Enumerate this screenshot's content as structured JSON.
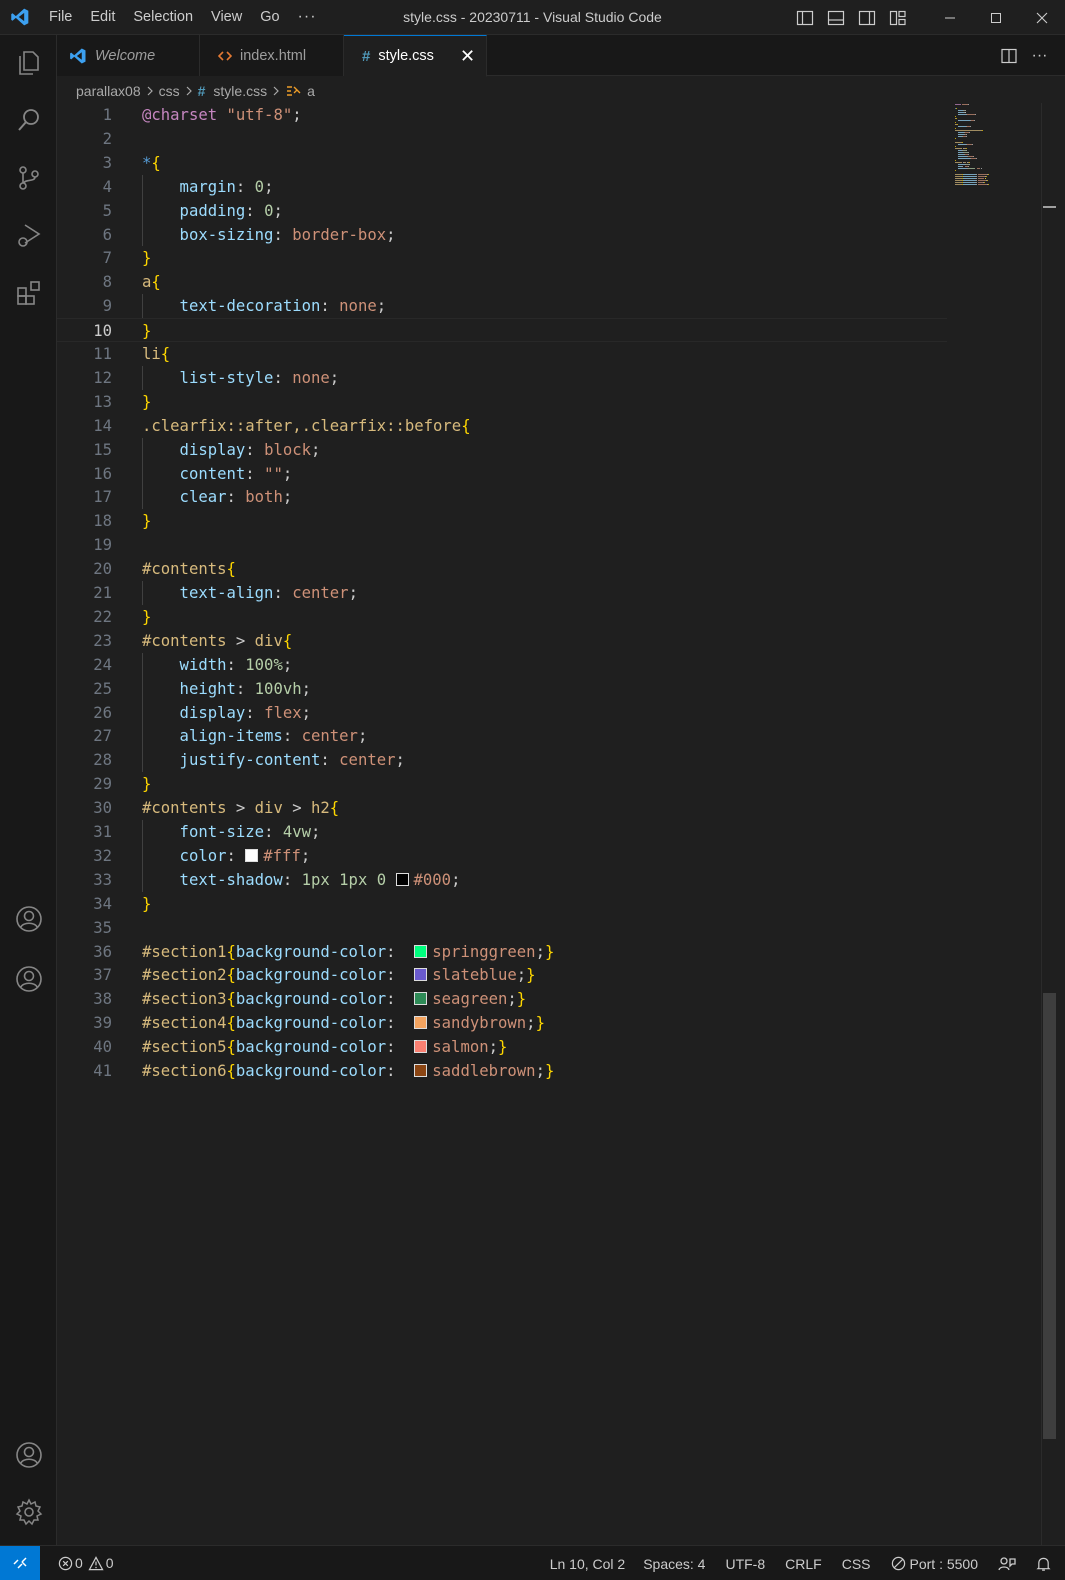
{
  "window": {
    "title": "style.css - 20230711 - Visual Studio Code",
    "menu": [
      "File",
      "Edit",
      "Selection",
      "View",
      "Go"
    ],
    "menu_more": "···"
  },
  "tabs": [
    {
      "label": "Welcome",
      "icon": "vscode-logo-icon",
      "italic": true
    },
    {
      "label": "index.html",
      "icon": "html-file-icon"
    },
    {
      "label": "style.css",
      "icon": "css-file-icon",
      "active": true,
      "close": "✕"
    }
  ],
  "breadcrumb": {
    "folder1": "parallax08",
    "folder2": "css",
    "file_glyph": "#",
    "file": "style.css",
    "symbol": "a"
  },
  "editor": {
    "current_line": 10,
    "lines": [
      {
        "n": "1",
        "tokens": [
          {
            "t": "@charset",
            "c": "at"
          },
          {
            "t": " ",
            "c": "punc"
          },
          {
            "t": "\"utf-8\"",
            "c": "str"
          },
          {
            "t": ";",
            "c": "punc"
          }
        ]
      },
      {
        "n": "2",
        "tokens": []
      },
      {
        "n": "3",
        "tokens": [
          {
            "t": "*",
            "c": "star"
          },
          {
            "t": "{",
            "c": "brace"
          }
        ]
      },
      {
        "n": "4",
        "tokens": [
          {
            "t": "    margin",
            "c": "prop"
          },
          {
            "t": ": ",
            "c": "punc"
          },
          {
            "t": "0",
            "c": "num"
          },
          {
            "t": ";",
            "c": "punc"
          }
        ]
      },
      {
        "n": "5",
        "tokens": [
          {
            "t": "    padding",
            "c": "prop"
          },
          {
            "t": ": ",
            "c": "punc"
          },
          {
            "t": "0",
            "c": "num"
          },
          {
            "t": ";",
            "c": "punc"
          }
        ]
      },
      {
        "n": "6",
        "tokens": [
          {
            "t": "    box-sizing",
            "c": "prop"
          },
          {
            "t": ": ",
            "c": "punc"
          },
          {
            "t": "border-box",
            "c": "val"
          },
          {
            "t": ";",
            "c": "punc"
          }
        ]
      },
      {
        "n": "7",
        "tokens": [
          {
            "t": "}",
            "c": "brace"
          }
        ]
      },
      {
        "n": "8",
        "tokens": [
          {
            "t": "a",
            "c": "tag"
          },
          {
            "t": "{",
            "c": "brace"
          }
        ]
      },
      {
        "n": "9",
        "tokens": [
          {
            "t": "    text-decoration",
            "c": "prop"
          },
          {
            "t": ": ",
            "c": "punc"
          },
          {
            "t": "none",
            "c": "val"
          },
          {
            "t": ";",
            "c": "punc"
          }
        ]
      },
      {
        "n": "10",
        "tokens": [
          {
            "t": "}",
            "c": "brace"
          }
        ]
      },
      {
        "n": "11",
        "tokens": [
          {
            "t": "li",
            "c": "tag"
          },
          {
            "t": "{",
            "c": "brace"
          }
        ]
      },
      {
        "n": "12",
        "tokens": [
          {
            "t": "    list-style",
            "c": "prop"
          },
          {
            "t": ": ",
            "c": "punc"
          },
          {
            "t": "none",
            "c": "val"
          },
          {
            "t": ";",
            "c": "punc"
          }
        ]
      },
      {
        "n": "13",
        "tokens": [
          {
            "t": "}",
            "c": "brace"
          }
        ]
      },
      {
        "n": "14",
        "tokens": [
          {
            "t": ".clearfix::after,.clearfix::before",
            "c": "sel"
          },
          {
            "t": "{",
            "c": "brace"
          }
        ]
      },
      {
        "n": "15",
        "tokens": [
          {
            "t": "    display",
            "c": "prop"
          },
          {
            "t": ": ",
            "c": "punc"
          },
          {
            "t": "block",
            "c": "val"
          },
          {
            "t": ";",
            "c": "punc"
          }
        ]
      },
      {
        "n": "16",
        "tokens": [
          {
            "t": "    content",
            "c": "prop"
          },
          {
            "t": ": ",
            "c": "punc"
          },
          {
            "t": "\"\"",
            "c": "str"
          },
          {
            "t": ";",
            "c": "punc"
          }
        ]
      },
      {
        "n": "17",
        "tokens": [
          {
            "t": "    clear",
            "c": "prop"
          },
          {
            "t": ": ",
            "c": "punc"
          },
          {
            "t": "both",
            "c": "val"
          },
          {
            "t": ";",
            "c": "punc"
          }
        ]
      },
      {
        "n": "18",
        "tokens": [
          {
            "t": "}",
            "c": "brace"
          }
        ]
      },
      {
        "n": "19",
        "tokens": []
      },
      {
        "n": "20",
        "tokens": [
          {
            "t": "#contents",
            "c": "sel"
          },
          {
            "t": "{",
            "c": "brace"
          }
        ]
      },
      {
        "n": "21",
        "tokens": [
          {
            "t": "    text-align",
            "c": "prop"
          },
          {
            "t": ": ",
            "c": "punc"
          },
          {
            "t": "center",
            "c": "val"
          },
          {
            "t": ";",
            "c": "punc"
          }
        ]
      },
      {
        "n": "22",
        "tokens": [
          {
            "t": "}",
            "c": "brace"
          }
        ]
      },
      {
        "n": "23",
        "tokens": [
          {
            "t": "#contents",
            "c": "sel"
          },
          {
            "t": " > ",
            "c": "punc"
          },
          {
            "t": "div",
            "c": "tag"
          },
          {
            "t": "{",
            "c": "brace"
          }
        ]
      },
      {
        "n": "24",
        "tokens": [
          {
            "t": "    width",
            "c": "prop"
          },
          {
            "t": ": ",
            "c": "punc"
          },
          {
            "t": "100%",
            "c": "num"
          },
          {
            "t": ";",
            "c": "punc"
          }
        ]
      },
      {
        "n": "25",
        "tokens": [
          {
            "t": "    height",
            "c": "prop"
          },
          {
            "t": ": ",
            "c": "punc"
          },
          {
            "t": "100vh",
            "c": "num"
          },
          {
            "t": ";",
            "c": "punc"
          }
        ]
      },
      {
        "n": "26",
        "tokens": [
          {
            "t": "    display",
            "c": "prop"
          },
          {
            "t": ": ",
            "c": "punc"
          },
          {
            "t": "flex",
            "c": "val"
          },
          {
            "t": ";",
            "c": "punc"
          }
        ]
      },
      {
        "n": "27",
        "tokens": [
          {
            "t": "    align-items",
            "c": "prop"
          },
          {
            "t": ": ",
            "c": "punc"
          },
          {
            "t": "center",
            "c": "val"
          },
          {
            "t": ";",
            "c": "punc"
          }
        ]
      },
      {
        "n": "28",
        "tokens": [
          {
            "t": "    justify-content",
            "c": "prop"
          },
          {
            "t": ": ",
            "c": "punc"
          },
          {
            "t": "center",
            "c": "val"
          },
          {
            "t": ";",
            "c": "punc"
          }
        ]
      },
      {
        "n": "29",
        "tokens": [
          {
            "t": "}",
            "c": "brace"
          }
        ]
      },
      {
        "n": "30",
        "tokens": [
          {
            "t": "#contents",
            "c": "sel"
          },
          {
            "t": " > ",
            "c": "punc"
          },
          {
            "t": "div",
            "c": "tag"
          },
          {
            "t": " > ",
            "c": "punc"
          },
          {
            "t": "h2",
            "c": "tag"
          },
          {
            "t": "{",
            "c": "brace"
          }
        ]
      },
      {
        "n": "31",
        "tokens": [
          {
            "t": "    font-size",
            "c": "prop"
          },
          {
            "t": ": ",
            "c": "punc"
          },
          {
            "t": "4vw",
            "c": "num"
          },
          {
            "t": ";",
            "c": "punc"
          }
        ]
      },
      {
        "n": "32",
        "tokens": [
          {
            "t": "    color",
            "c": "prop"
          },
          {
            "t": ": ",
            "c": "punc"
          },
          {
            "t": "",
            "c": "swatch",
            "color": "#ffffff"
          },
          {
            "t": "#fff",
            "c": "val"
          },
          {
            "t": ";",
            "c": "punc"
          }
        ]
      },
      {
        "n": "33",
        "tokens": [
          {
            "t": "    text-shadow",
            "c": "prop"
          },
          {
            "t": ": ",
            "c": "punc"
          },
          {
            "t": "1px 1px 0",
            "c": "num"
          },
          {
            "t": " ",
            "c": "punc"
          },
          {
            "t": "",
            "c": "swatch",
            "color": "#000000"
          },
          {
            "t": "#000",
            "c": "val"
          },
          {
            "t": ";",
            "c": "punc"
          }
        ]
      },
      {
        "n": "34",
        "tokens": [
          {
            "t": "}",
            "c": "brace"
          }
        ]
      },
      {
        "n": "35",
        "tokens": []
      },
      {
        "n": "36",
        "tokens": [
          {
            "t": "#section1",
            "c": "sel"
          },
          {
            "t": "{",
            "c": "brace"
          },
          {
            "t": "background-color",
            "c": "prop"
          },
          {
            "t": ":  ",
            "c": "punc"
          },
          {
            "t": "",
            "c": "swatch",
            "color": "#00ff7f"
          },
          {
            "t": "springgreen",
            "c": "val"
          },
          {
            "t": ";",
            "c": "punc"
          },
          {
            "t": "}",
            "c": "brace"
          }
        ]
      },
      {
        "n": "37",
        "tokens": [
          {
            "t": "#section2",
            "c": "sel"
          },
          {
            "t": "{",
            "c": "brace"
          },
          {
            "t": "background-color",
            "c": "prop"
          },
          {
            "t": ":  ",
            "c": "punc"
          },
          {
            "t": "",
            "c": "swatch",
            "color": "#6a5acd"
          },
          {
            "t": "slateblue",
            "c": "val"
          },
          {
            "t": ";",
            "c": "punc"
          },
          {
            "t": "}",
            "c": "brace"
          }
        ]
      },
      {
        "n": "38",
        "tokens": [
          {
            "t": "#section3",
            "c": "sel"
          },
          {
            "t": "{",
            "c": "brace"
          },
          {
            "t": "background-color",
            "c": "prop"
          },
          {
            "t": ":  ",
            "c": "punc"
          },
          {
            "t": "",
            "c": "swatch",
            "color": "#2e8b57"
          },
          {
            "t": "seagreen",
            "c": "val"
          },
          {
            "t": ";",
            "c": "punc"
          },
          {
            "t": "}",
            "c": "brace"
          }
        ]
      },
      {
        "n": "39",
        "tokens": [
          {
            "t": "#section4",
            "c": "sel"
          },
          {
            "t": "{",
            "c": "brace"
          },
          {
            "t": "background-color",
            "c": "prop"
          },
          {
            "t": ":  ",
            "c": "punc"
          },
          {
            "t": "",
            "c": "swatch",
            "color": "#f4a460"
          },
          {
            "t": "sandybrown",
            "c": "val"
          },
          {
            "t": ";",
            "c": "punc"
          },
          {
            "t": "}",
            "c": "brace"
          }
        ]
      },
      {
        "n": "40",
        "tokens": [
          {
            "t": "#section5",
            "c": "sel"
          },
          {
            "t": "{",
            "c": "brace"
          },
          {
            "t": "background-color",
            "c": "prop"
          },
          {
            "t": ":  ",
            "c": "punc"
          },
          {
            "t": "",
            "c": "swatch",
            "color": "#fa8072"
          },
          {
            "t": "salmon",
            "c": "val"
          },
          {
            "t": ";",
            "c": "punc"
          },
          {
            "t": "}",
            "c": "brace"
          }
        ]
      },
      {
        "n": "41",
        "tokens": [
          {
            "t": "#section6",
            "c": "sel"
          },
          {
            "t": "{",
            "c": "brace"
          },
          {
            "t": "background-color",
            "c": "prop"
          },
          {
            "t": ":  ",
            "c": "punc"
          },
          {
            "t": "",
            "c": "swatch",
            "color": "#8b4513"
          },
          {
            "t": "saddlebrown",
            "c": "val"
          },
          {
            "t": ";",
            "c": "punc"
          },
          {
            "t": "}",
            "c": "brace"
          }
        ]
      }
    ]
  },
  "statusbar": {
    "errors": "0",
    "warnings": "0",
    "position": "Ln 10, Col 2",
    "spaces": "Spaces: 4",
    "encoding": "UTF-8",
    "eol": "CRLF",
    "language": "CSS",
    "port": "Port : 5500"
  },
  "colors": {
    "accent": "#0078d4",
    "background": "#1f1f1f",
    "sidebar": "#181818"
  }
}
